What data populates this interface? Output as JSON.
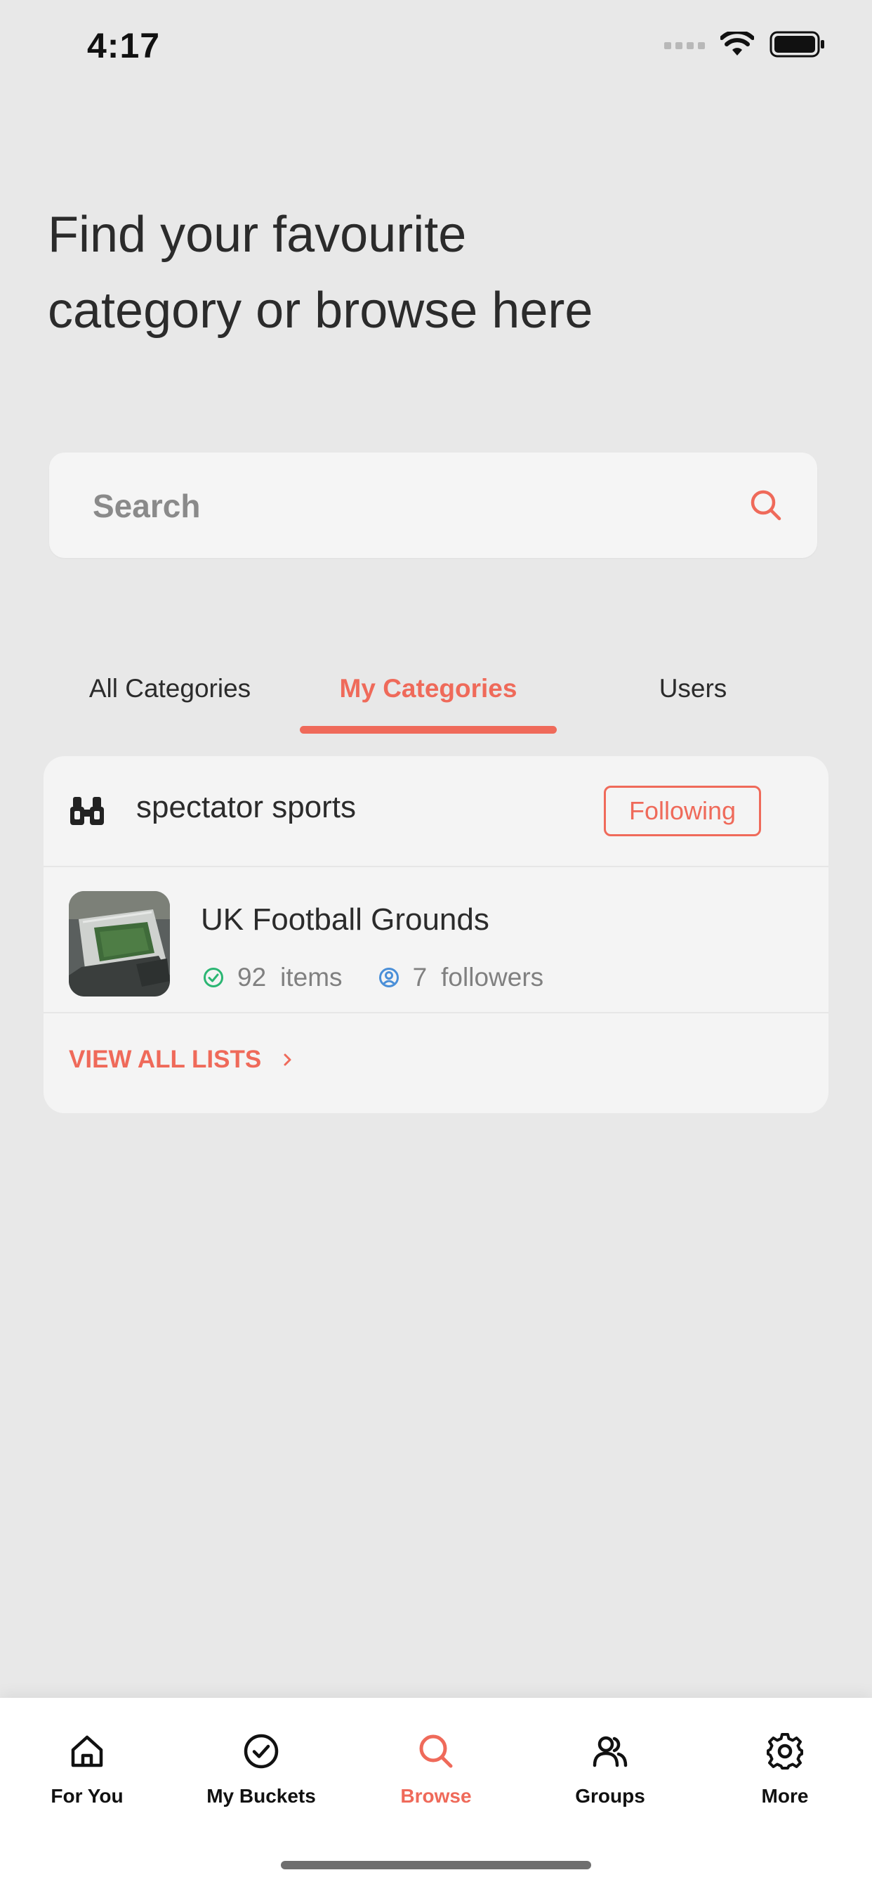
{
  "status": {
    "time": "4:17"
  },
  "heading": {
    "line1": "Find your favourite",
    "line2": "category or browse here"
  },
  "search": {
    "placeholder": "Search"
  },
  "tabs": [
    {
      "label": "All Categories"
    },
    {
      "label": "My Categories",
      "active": true
    },
    {
      "label": "Users"
    }
  ],
  "category": {
    "name": "spectator sports",
    "icon": "binoculars-icon",
    "follow_label": "Following",
    "list": {
      "title": "UK Football Grounds",
      "items_count": "92",
      "items_label": "items",
      "followers_count": "7",
      "followers_label": "followers"
    },
    "view_all_label": "VIEW ALL LISTS"
  },
  "tabbar": [
    {
      "label": "For You",
      "icon": "home-icon"
    },
    {
      "label": "My Buckets",
      "icon": "check-circle-icon"
    },
    {
      "label": "Browse",
      "icon": "search-icon",
      "active": true
    },
    {
      "label": "Groups",
      "icon": "users-icon"
    },
    {
      "label": "More",
      "icon": "gear-icon"
    }
  ],
  "colors": {
    "accent": "#ef6a5a",
    "background": "#e8e8e8",
    "card": "#f4f4f4",
    "items_icon": "#2bb673",
    "followers_icon": "#4a8fd8"
  }
}
